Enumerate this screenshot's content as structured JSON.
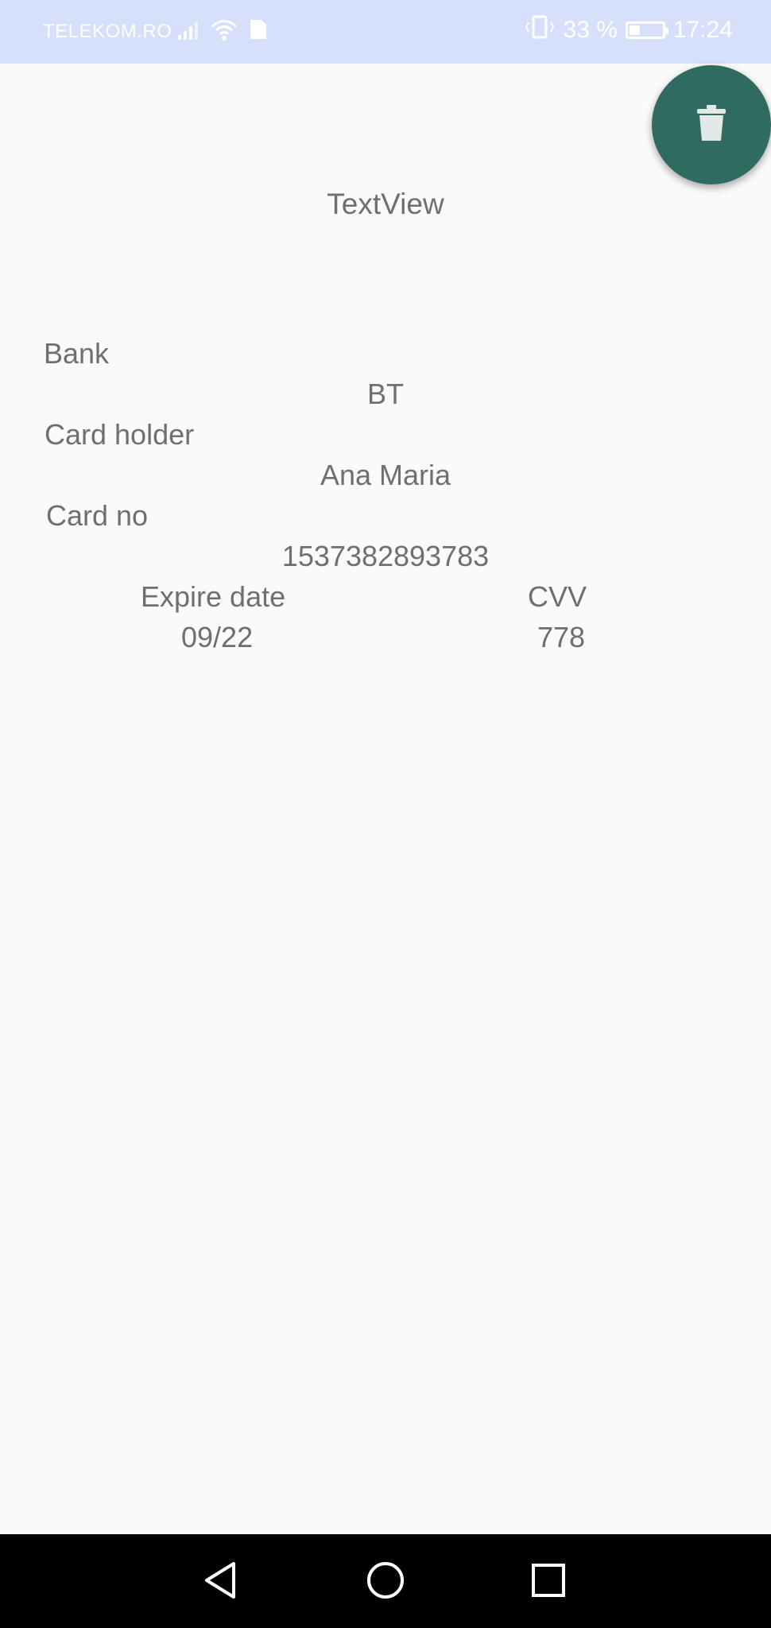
{
  "status_bar": {
    "carrier": "TELEKOM.RO",
    "battery": "33 %",
    "battery_level": 0.33,
    "time": "17:24",
    "icons": [
      "signal-icon",
      "wifi-icon",
      "sim-card-icon",
      "vibrate-icon",
      "battery-icon"
    ]
  },
  "fab": {
    "icon": "trash-icon",
    "color": "#2f6b61"
  },
  "screen": {
    "title": "TextView"
  },
  "card": {
    "bank_label": "Bank",
    "bank_value": "BT",
    "holder_label": "Card holder",
    "holder_value": "Ana Maria",
    "number_label": "Card no",
    "number_value": "1537382893783",
    "expire_label": "Expire date",
    "expire_value": "09/22",
    "cvv_label": "CVV",
    "cvv_value": "778"
  },
  "nav_bar": {
    "icons": [
      "back-icon",
      "home-icon",
      "recent-apps-icon"
    ]
  }
}
